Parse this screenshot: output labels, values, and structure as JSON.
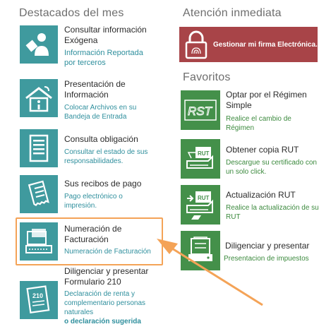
{
  "sections": {
    "destacados": "Destacados del mes",
    "atencion": "Atención inmediata",
    "favoritos": "Favoritos"
  },
  "banner": {
    "label": "Gestionar mi firma Electrónica."
  },
  "left_items": [
    {
      "title": "Consultar información Exógena",
      "desc": "Información Reportada por terceros",
      "icon": "person-document-icon"
    },
    {
      "title": "Presentación de Información",
      "desc": "Colocar Archivos en su Bandeja de Entrada",
      "icon": "house-info-icon"
    },
    {
      "title": "Consulta obligación",
      "desc": "Consultar el estado de sus responsabilidades.",
      "icon": "checklist-icon"
    },
    {
      "title": "Sus recibos de pago",
      "desc": "Pago electrónico o impresión.",
      "icon": "receipt-icon"
    },
    {
      "title": "Numeración de Facturación",
      "desc": "Numeración de Facturación",
      "icon": "invoice-keyboard-icon"
    },
    {
      "title": "Diligenciar y presentar Formulario 210",
      "desc": "Declaración de renta y complementario personas naturales",
      "extra": "o declaración sugerida",
      "icon": "form-210-icon",
      "tile_text": "210"
    }
  ],
  "favorites": [
    {
      "title": "Optar por el Régimen Simple",
      "desc": "Realice el cambio de Régimen",
      "icon": "rst-icon",
      "tile_text": "RST"
    },
    {
      "title": "Obtener copia RUT",
      "desc": "Descargue su certificado con un solo click.",
      "icon": "rut-copy-icon",
      "tile_text": "RUT"
    },
    {
      "title": "Actualización RUT",
      "desc": "Realice la actualización de su RUT",
      "icon": "rut-update-icon",
      "tile_text": "RUT"
    },
    {
      "title": "Diligenciar y presentar",
      "desc": "Presentacion de impuestos",
      "icon": "printer-receipt-icon"
    }
  ],
  "colors": {
    "teal": "#3f9a9e",
    "green": "#44904a",
    "banner": "#a84448",
    "highlight": "#f4a357"
  }
}
